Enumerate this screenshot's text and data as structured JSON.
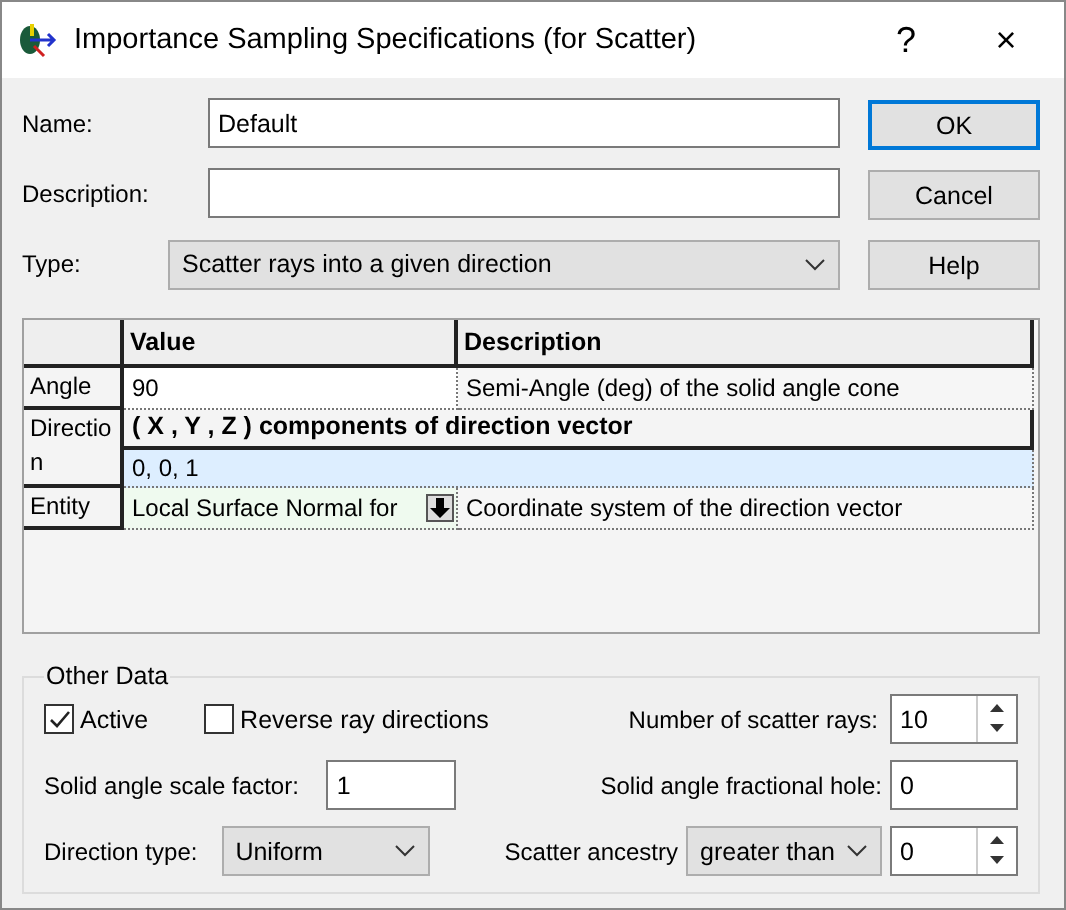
{
  "window": {
    "title": "Importance Sampling Specifications (for Scatter)",
    "help_glyph": "?",
    "close_glyph": "×"
  },
  "fields": [
    {
      "label": "Name:",
      "kind": "text",
      "value": "Default"
    },
    {
      "label": "Description:",
      "kind": "text"
    },
    {
      "label": "Type:",
      "kind": "dropdown",
      "value": "Scatter rays into a given direction"
    }
  ],
  "buttons": [
    {
      "label": "OK",
      "default": true
    },
    {
      "label": "Cancel",
      "default": false
    },
    {
      "label": "Help",
      "default": false
    }
  ],
  "table": {
    "columns": [
      "Value",
      "Description"
    ],
    "rows": [
      {
        "label": "Angle",
        "kind": "plain",
        "value": "90",
        "description": "Semi-Angle (deg) of the solid angle cone",
        "selected": false
      },
      {
        "label": "Direction",
        "kind": "vector",
        "heading": "( X , Y , Z ) components of direction vector",
        "value": "0,  0,  1",
        "selected": true
      },
      {
        "label": "Entity",
        "kind": "dropdown",
        "value": "Local Surface Normal for",
        "description": "Coordinate system of the direction vector",
        "selected": false
      }
    ]
  },
  "other_data": {
    "title": "Other Data",
    "checkboxes": [
      {
        "label": "Active",
        "checked": true
      },
      {
        "label": "Reverse ray directions",
        "checked": false
      }
    ],
    "scatter_rays": {
      "label": "Number of scatter rays:",
      "value": "10"
    },
    "scale_factor": {
      "label": "Solid angle scale factor:",
      "value": "1"
    },
    "fractional_hole": {
      "label": "Solid angle fractional hole:",
      "value": "0"
    },
    "direction_type": {
      "label": "Direction type:",
      "value": "Uniform"
    },
    "scatter_ancestry": {
      "label": "Scatter ancestry",
      "value": "greater than",
      "count": "0"
    }
  }
}
